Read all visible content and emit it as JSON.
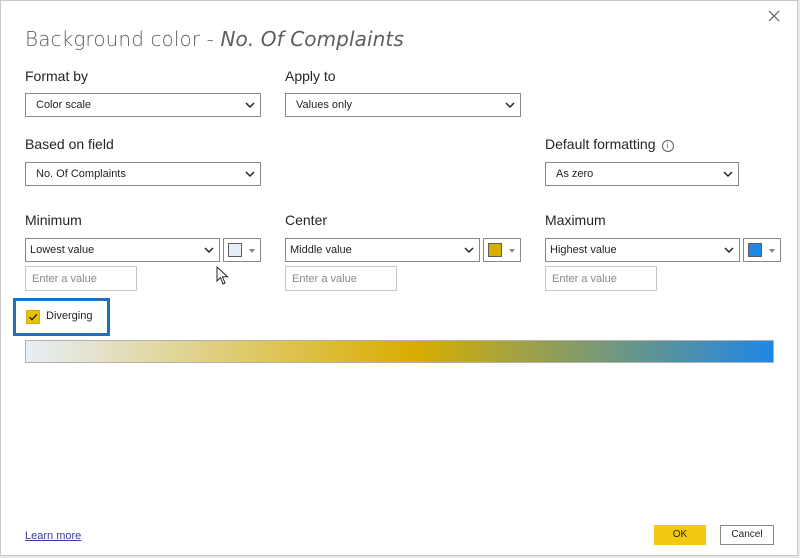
{
  "dialog": {
    "title_prefix": "Background color - ",
    "title_field": "No. Of Complaints"
  },
  "format_by": {
    "label": "Format by",
    "value": "Color scale"
  },
  "apply_to": {
    "label": "Apply to",
    "value": "Values only"
  },
  "based_on": {
    "label": "Based on field",
    "value": "No. Of Complaints"
  },
  "default_formatting": {
    "label": "Default formatting",
    "info_icon": "info-icon",
    "value": "As zero"
  },
  "minimum": {
    "label": "Minimum",
    "value": "Lowest value",
    "color": "#e6eef7",
    "placeholder": "Enter a value"
  },
  "center": {
    "label": "Center",
    "value": "Middle value",
    "color": "#d9ad00",
    "placeholder": "Enter a value"
  },
  "maximum": {
    "label": "Maximum",
    "value": "Highest value",
    "color": "#1f87e5",
    "placeholder": "Enter a value"
  },
  "diverging": {
    "label": "Diverging",
    "checked": true,
    "checkmark": "✓"
  },
  "footer": {
    "learn_more": "Learn more",
    "ok": "OK",
    "cancel": "Cancel"
  }
}
